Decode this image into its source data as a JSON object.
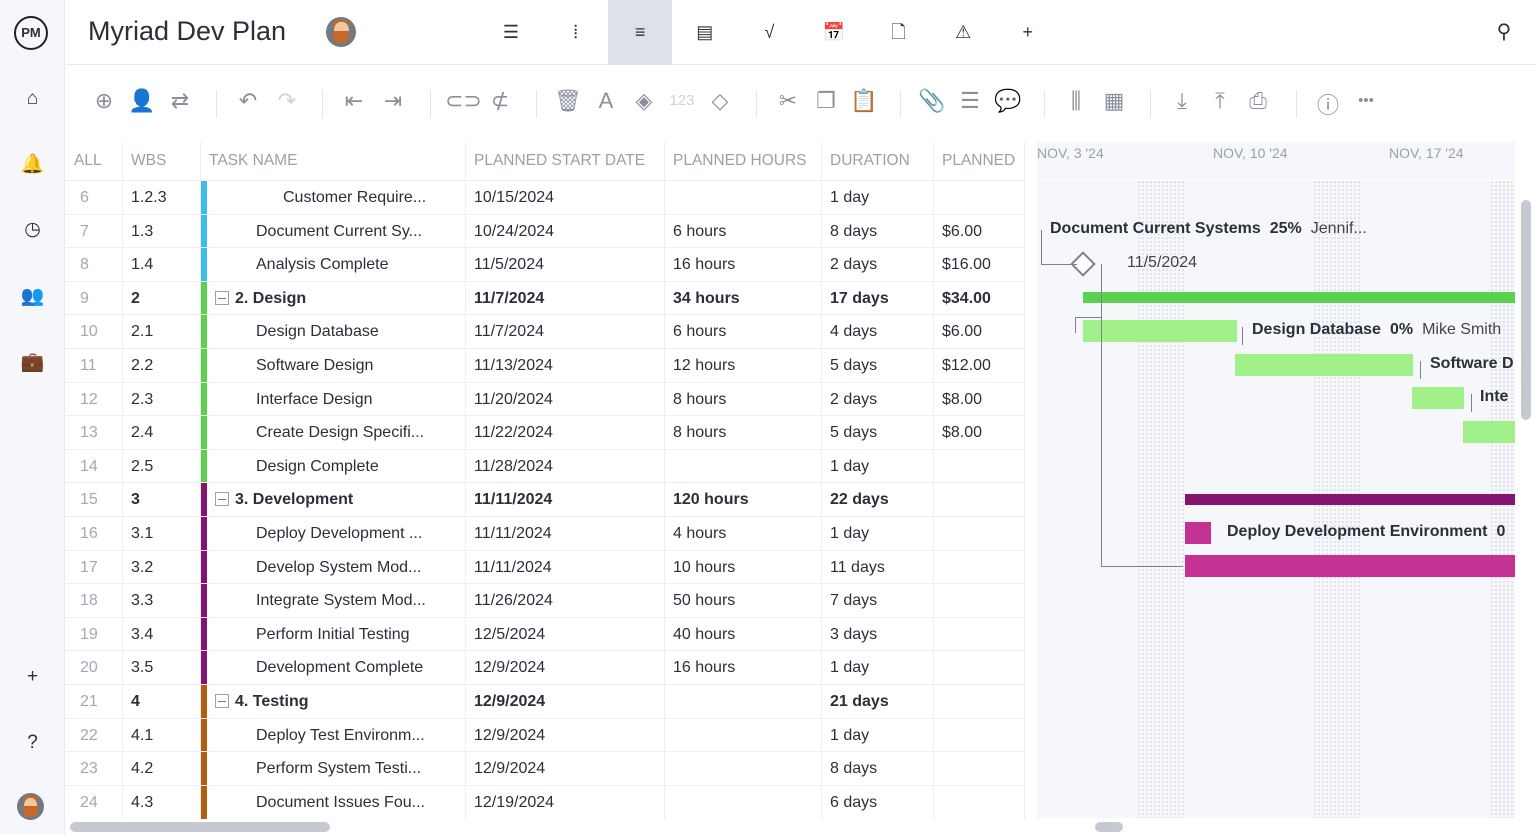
{
  "app": {
    "logo": "PM",
    "title": "Myriad Dev Plan"
  },
  "sidebar": {
    "items": [
      {
        "icon": "home-icon",
        "glyph": "⌂"
      },
      {
        "icon": "notification-bell-icon",
        "glyph": "🔔"
      },
      {
        "icon": "clock-icon",
        "glyph": "◷"
      },
      {
        "icon": "people-icon",
        "glyph": "👥"
      },
      {
        "icon": "briefcase-icon",
        "glyph": "💼"
      },
      {
        "icon": "plus-icon",
        "glyph": "+"
      },
      {
        "icon": "help-icon",
        "glyph": "?"
      }
    ]
  },
  "views": [
    {
      "icon": "list-view-icon",
      "glyph": "☰"
    },
    {
      "icon": "board-view-icon",
      "glyph": "⦙"
    },
    {
      "icon": "gantt-view-icon",
      "glyph": "≡",
      "active": true
    },
    {
      "icon": "sheet-view-icon",
      "glyph": "▤"
    },
    {
      "icon": "dashboard-view-icon",
      "glyph": "√"
    },
    {
      "icon": "calendar-view-icon",
      "glyph": "📅"
    },
    {
      "icon": "files-icon",
      "glyph": "🗋"
    },
    {
      "icon": "risk-icon",
      "glyph": "⚠"
    },
    {
      "icon": "add-view-icon",
      "glyph": "+"
    }
  ],
  "toolbar": [
    {
      "icon": "add-task-icon",
      "glyph": "⊕"
    },
    {
      "icon": "assign-user-icon",
      "glyph": "👤"
    },
    {
      "icon": "recurring-icon",
      "glyph": "⇄"
    },
    {
      "icon": "undo-icon",
      "glyph": "↶"
    },
    {
      "icon": "redo-icon",
      "glyph": "↷",
      "dim": true
    },
    {
      "icon": "outdent-icon",
      "glyph": "⇤"
    },
    {
      "icon": "indent-icon",
      "glyph": "⇥"
    },
    {
      "icon": "link-icon",
      "glyph": "⊂⊃"
    },
    {
      "icon": "unlink-icon",
      "glyph": "⊄"
    },
    {
      "icon": "delete-icon",
      "glyph": "🗑"
    },
    {
      "icon": "text-color-icon",
      "glyph": "A"
    },
    {
      "icon": "fill-color-icon",
      "glyph": "◈"
    },
    {
      "icon": "number-format-icon",
      "glyph": "123",
      "dim": true
    },
    {
      "icon": "milestone-icon",
      "glyph": "◇"
    },
    {
      "icon": "cut-icon",
      "glyph": "✂"
    },
    {
      "icon": "copy-icon",
      "glyph": "❐"
    },
    {
      "icon": "paste-icon",
      "glyph": "📋"
    },
    {
      "icon": "attachment-icon",
      "glyph": "📎"
    },
    {
      "icon": "notes-icon",
      "glyph": "☰"
    },
    {
      "icon": "comment-icon",
      "glyph": "💬"
    },
    {
      "icon": "columns-icon",
      "glyph": "⫼"
    },
    {
      "icon": "grid-icon",
      "glyph": "▦"
    },
    {
      "icon": "import-icon",
      "glyph": "⤓"
    },
    {
      "icon": "export-icon",
      "glyph": "⤒"
    },
    {
      "icon": "print-icon",
      "glyph": "⎙"
    },
    {
      "icon": "info-icon",
      "glyph": "ⓘ"
    },
    {
      "icon": "more-icon",
      "glyph": "•••"
    }
  ],
  "table": {
    "columns": [
      "ALL",
      "WBS",
      "TASK NAME",
      "PLANNED START DATE",
      "PLANNED HOURS",
      "DURATION",
      "PLANNED"
    ],
    "rows": [
      {
        "n": "6",
        "wbs": "1.2.3",
        "name": "Customer Require...",
        "start": "10/15/2024",
        "hours": "",
        "dur": "1 day",
        "cost": "",
        "color": "#3bbfe8",
        "indent": 3
      },
      {
        "n": "7",
        "wbs": "1.3",
        "name": "Document Current Sy...",
        "start": "10/24/2024",
        "hours": "6 hours",
        "dur": "8 days",
        "cost": "$6.00",
        "color": "#3bbfe8",
        "indent": 2
      },
      {
        "n": "8",
        "wbs": "1.4",
        "name": "Analysis Complete",
        "start": "11/5/2024",
        "hours": "16 hours",
        "dur": "2 days",
        "cost": "$16.00",
        "color": "#3bbfe8",
        "indent": 2
      },
      {
        "n": "9",
        "wbs": "2",
        "name": "2. Design",
        "start": "11/7/2024",
        "hours": "34 hours",
        "dur": "17 days",
        "cost": "$34.00",
        "color": "#5bd14f",
        "bold": true
      },
      {
        "n": "10",
        "wbs": "2.1",
        "name": "Design Database",
        "start": "11/7/2024",
        "hours": "6 hours",
        "dur": "4 days",
        "cost": "$6.00",
        "color": "#5bd14f",
        "indent": 2
      },
      {
        "n": "11",
        "wbs": "2.2",
        "name": "Software Design",
        "start": "11/13/2024",
        "hours": "12 hours",
        "dur": "5 days",
        "cost": "$12.00",
        "color": "#5bd14f",
        "indent": 2
      },
      {
        "n": "12",
        "wbs": "2.3",
        "name": "Interface Design",
        "start": "11/20/2024",
        "hours": "8 hours",
        "dur": "2 days",
        "cost": "$8.00",
        "color": "#5bd14f",
        "indent": 2
      },
      {
        "n": "13",
        "wbs": "2.4",
        "name": "Create Design Specifi...",
        "start": "11/22/2024",
        "hours": "8 hours",
        "dur": "5 days",
        "cost": "$8.00",
        "color": "#5bd14f",
        "indent": 2
      },
      {
        "n": "14",
        "wbs": "2.5",
        "name": "Design Complete",
        "start": "11/28/2024",
        "hours": "",
        "dur": "1 day",
        "cost": "",
        "color": "#5bd14f",
        "indent": 2
      },
      {
        "n": "15",
        "wbs": "3",
        "name": "3. Development",
        "start": "11/11/2024",
        "hours": "120 hours",
        "dur": "22 days",
        "cost": "",
        "color": "#84146f",
        "bold": true
      },
      {
        "n": "16",
        "wbs": "3.1",
        "name": "Deploy Development ...",
        "start": "11/11/2024",
        "hours": "4 hours",
        "dur": "1 day",
        "cost": "",
        "color": "#84146f",
        "indent": 2
      },
      {
        "n": "17",
        "wbs": "3.2",
        "name": "Develop System Mod...",
        "start": "11/11/2024",
        "hours": "10 hours",
        "dur": "11 days",
        "cost": "",
        "color": "#84146f",
        "indent": 2
      },
      {
        "n": "18",
        "wbs": "3.3",
        "name": "Integrate System Mod...",
        "start": "11/26/2024",
        "hours": "50 hours",
        "dur": "7 days",
        "cost": "",
        "color": "#84146f",
        "indent": 2
      },
      {
        "n": "19",
        "wbs": "3.4",
        "name": "Perform Initial Testing",
        "start": "12/5/2024",
        "hours": "40 hours",
        "dur": "3 days",
        "cost": "",
        "color": "#84146f",
        "indent": 2
      },
      {
        "n": "20",
        "wbs": "3.5",
        "name": "Development Complete",
        "start": "12/9/2024",
        "hours": "16 hours",
        "dur": "1 day",
        "cost": "",
        "color": "#84146f",
        "indent": 2
      },
      {
        "n": "21",
        "wbs": "4",
        "name": "4. Testing",
        "start": "12/9/2024",
        "hours": "",
        "dur": "21 days",
        "cost": "",
        "color": "#b35d0e",
        "bold": true
      },
      {
        "n": "22",
        "wbs": "4.1",
        "name": "Deploy Test Environm...",
        "start": "12/9/2024",
        "hours": "",
        "dur": "1 day",
        "cost": "",
        "color": "#b35d0e",
        "indent": 2
      },
      {
        "n": "23",
        "wbs": "4.2",
        "name": "Perform System Testi...",
        "start": "12/9/2024",
        "hours": "",
        "dur": "8 days",
        "cost": "",
        "color": "#b35d0e",
        "indent": 2
      },
      {
        "n": "24",
        "wbs": "4.3",
        "name": "Document Issues Fou...",
        "start": "12/19/2024",
        "hours": "",
        "dur": "6 days",
        "cost": "",
        "color": "#b35d0e",
        "indent": 2
      }
    ]
  },
  "gantt": {
    "weeks": [
      "NOV, 3 '24",
      "NOV, 10 '24",
      "NOV, 17 '24"
    ],
    "labels": [
      {
        "row": 1,
        "name": "Document Current Systems",
        "pct": "25%",
        "who": "Jennif..."
      },
      {
        "row": 2,
        "name": "",
        "pct": "",
        "who": "11/5/2024"
      },
      {
        "row": 4,
        "name": "Design Database",
        "pct": "0%",
        "who": "Mike Smith"
      },
      {
        "row": 5,
        "name": "Software D",
        "pct": "",
        "who": ""
      },
      {
        "row": 6,
        "name": "Inte",
        "pct": "",
        "who": ""
      },
      {
        "row": 10,
        "name": "Deploy Development Environment",
        "pct": "0",
        "who": ""
      }
    ],
    "colors": {
      "design_summary": "#5bd14f",
      "design_task": "#a2f08a",
      "dev_summary": "#84146f",
      "dev_task": "#c43394"
    }
  }
}
